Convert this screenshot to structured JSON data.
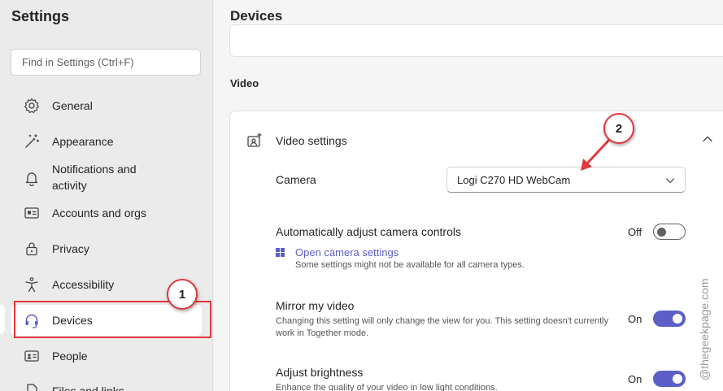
{
  "sidebar": {
    "title": "Settings",
    "search_placeholder": "Find in Settings (Ctrl+F)",
    "items": [
      {
        "label": "General",
        "icon": "gear-icon"
      },
      {
        "label": "Appearance",
        "icon": "magic-wand-icon"
      },
      {
        "label": "Notifications and activity",
        "icon": "bell-icon"
      },
      {
        "label": "Accounts and orgs",
        "icon": "id-card-icon"
      },
      {
        "label": "Privacy",
        "icon": "lock-icon"
      },
      {
        "label": "Accessibility",
        "icon": "accessibility-icon"
      },
      {
        "label": "Devices",
        "icon": "headset-icon",
        "selected": true
      },
      {
        "label": "People",
        "icon": "contact-card-icon"
      },
      {
        "label": "Files and links",
        "icon": "file-icon"
      }
    ]
  },
  "main": {
    "title": "Devices",
    "section": "Video",
    "video_settings": {
      "title": "Video settings",
      "camera_label": "Camera",
      "camera_value": "Logi C270 HD WebCam",
      "auto_adjust": {
        "title": "Automatically adjust camera controls",
        "state": "Off",
        "link": "Open camera settings",
        "note": "Some settings might not be available for all camera types."
      },
      "mirror": {
        "title": "Mirror my video",
        "desc": "Changing this setting will only change the view for you. This setting doesn't currently work in Together mode.",
        "state": "On"
      },
      "brightness": {
        "title": "Adjust brightness",
        "desc": "Enhance the quality of your video in low light conditions.",
        "state": "On"
      }
    }
  },
  "annotations": {
    "callout_1": "1",
    "callout_2": "2",
    "watermark": "@thegeekpage.com"
  },
  "colors": {
    "accent": "#5b5fc7",
    "annotation_red": "#e0393e"
  }
}
